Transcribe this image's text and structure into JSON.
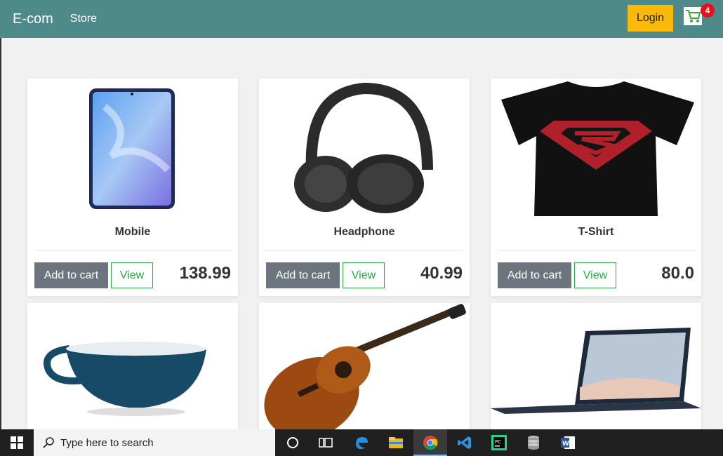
{
  "navbar": {
    "brand": "E-com",
    "store_link": "Store",
    "login_label": "Login",
    "cart_count": "4"
  },
  "products": [
    {
      "title": "Mobile",
      "price": "138.99",
      "add_label": "Add to cart",
      "view_label": "View"
    },
    {
      "title": "Headphone",
      "price": "40.99",
      "add_label": "Add to cart",
      "view_label": "View"
    },
    {
      "title": "T-Shirt",
      "price": "80.0",
      "add_label": "Add to cart",
      "view_label": "View"
    }
  ],
  "taskbar": {
    "search_placeholder": "Type here to search"
  },
  "colors": {
    "navbar": "#4f8a8b",
    "login": "#fbba0a",
    "badge": "#e8101a",
    "view_outline": "#28a745",
    "add_button": "#6c757d"
  }
}
